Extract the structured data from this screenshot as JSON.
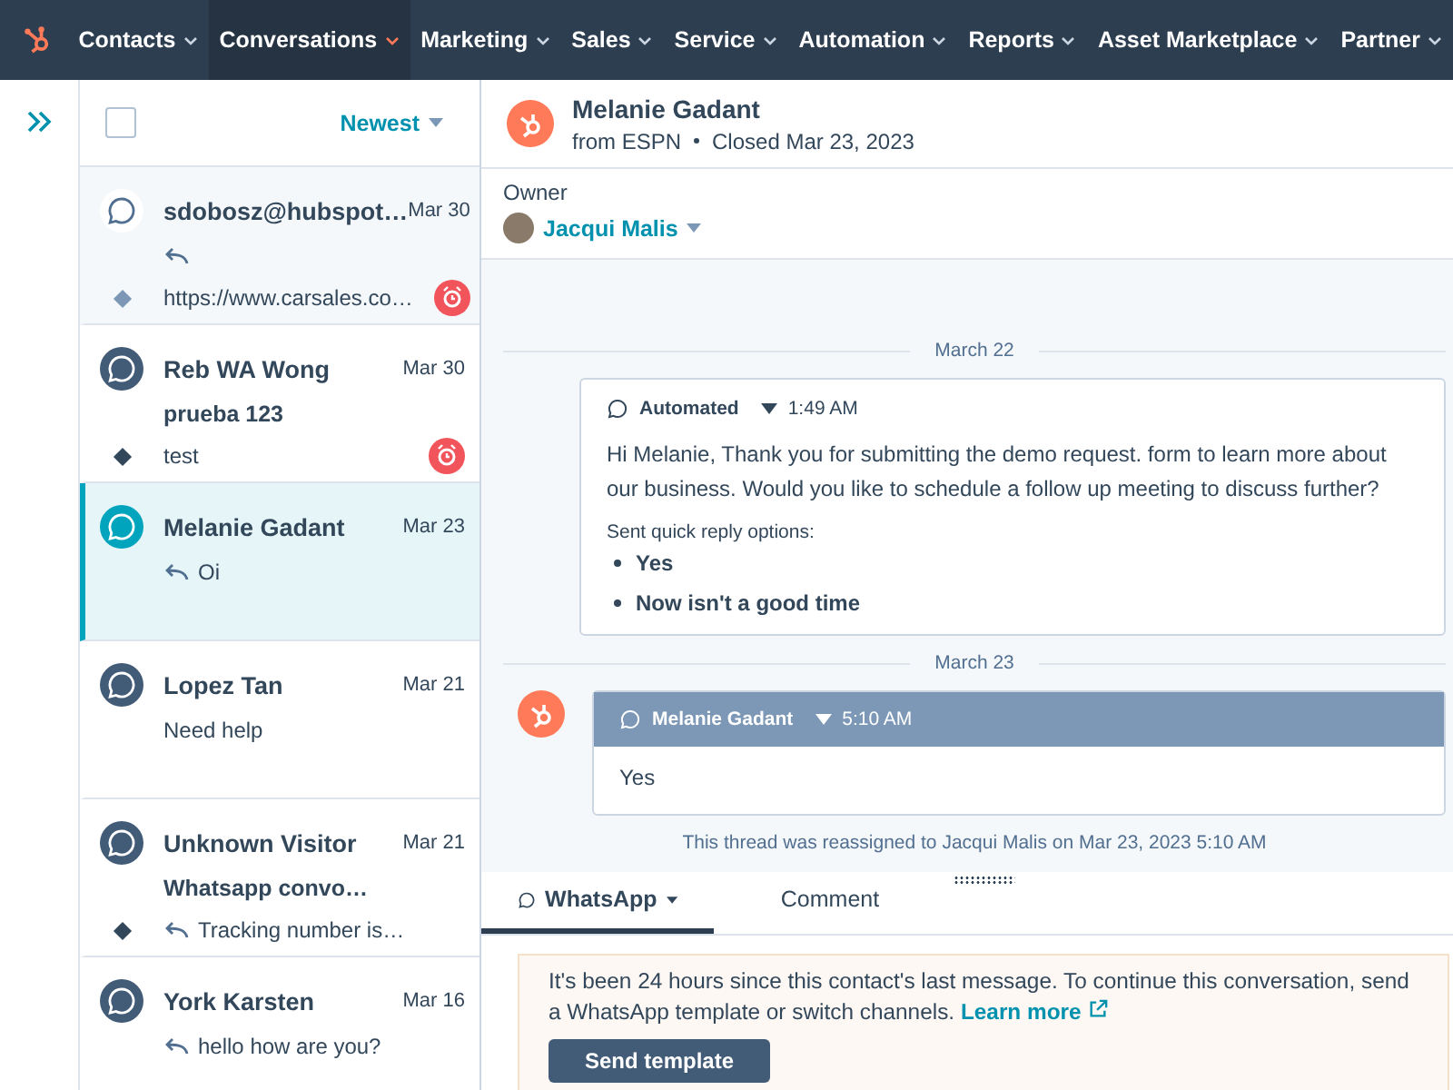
{
  "nav": {
    "items": [
      {
        "label": "Contacts",
        "selected": false
      },
      {
        "label": "Conversations",
        "selected": true
      },
      {
        "label": "Marketing",
        "selected": false
      },
      {
        "label": "Sales",
        "selected": false
      },
      {
        "label": "Service",
        "selected": false
      },
      {
        "label": "Automation",
        "selected": false
      },
      {
        "label": "Reports",
        "selected": false
      },
      {
        "label": "Asset Marketplace",
        "selected": false
      },
      {
        "label": "Partner",
        "selected": false
      }
    ]
  },
  "inbox": {
    "select_all": {
      "checked": false
    },
    "sort": "Newest",
    "conversations": [
      {
        "name": "sdobosz@hubspot…",
        "date": "Mar 30",
        "kind": "muted",
        "selected": false,
        "ticket": true,
        "alert": true,
        "lines": [
          {
            "kind": "preview",
            "reply": true
          },
          {
            "kind": "preview",
            "text": "https://www.carsales.co…",
            "reply": false
          }
        ]
      },
      {
        "name": "Reb WA Wong",
        "date": "Mar 30",
        "kind": "normal",
        "selected": false,
        "ticket": true,
        "alert": true,
        "lines": [
          {
            "kind": "subject",
            "text": "prueba 123",
            "reply": false
          },
          {
            "kind": "preview",
            "text": "test",
            "reply": false
          }
        ]
      },
      {
        "name": "Melanie Gadant",
        "date": "Mar 23",
        "kind": "normal",
        "selected": true,
        "ticket": false,
        "alert": false,
        "lines": [
          {
            "kind": "preview",
            "text": "Oi",
            "reply": true
          }
        ]
      },
      {
        "name": "Lopez Tan",
        "date": "Mar 21",
        "kind": "normal",
        "selected": false,
        "ticket": false,
        "alert": false,
        "lines": [
          {
            "kind": "preview",
            "text": "Need help",
            "reply": false
          }
        ]
      },
      {
        "name": "Unknown Visitor",
        "date": "Mar 21",
        "kind": "normal",
        "selected": false,
        "ticket": true,
        "alert": false,
        "lines": [
          {
            "kind": "subject",
            "text": "Whatsapp convo…",
            "reply": false
          },
          {
            "kind": "preview",
            "text": "Tracking number is…",
            "reply": true
          }
        ]
      },
      {
        "name": "York Karsten",
        "date": "Mar 16",
        "kind": "normal",
        "selected": false,
        "ticket": false,
        "alert": false,
        "lines": [
          {
            "kind": "preview",
            "text": "hello how are you?",
            "reply": true
          }
        ]
      }
    ]
  },
  "contact": {
    "name": "Melanie Gadant",
    "company": "from ESPN",
    "status": "Closed Mar 23, 2023",
    "owner_label": "Owner",
    "owner": "Jacqui Malis"
  },
  "thread": [
    {
      "kind": "date",
      "text": "March 22"
    },
    {
      "kind": "message",
      "sender": "Automated",
      "time": "1:49 AM",
      "incoming": false,
      "body": "Hi Melanie, Thank you for submitting the demo request. form to learn more about our business. Would you like to schedule a follow up meeting to discuss further?",
      "options_label": "Sent quick reply options:",
      "options": [
        "Yes",
        "Now isn't a good time"
      ]
    },
    {
      "kind": "date",
      "text": "March 23"
    },
    {
      "kind": "message",
      "sender": "Melanie Gadant",
      "time": "5:10 AM",
      "incoming": true,
      "body": "Yes"
    },
    {
      "kind": "event",
      "text": "This thread was reassigned to Jacqui Malis on Mar 23, 2023 5:10 AM"
    }
  ],
  "composer": {
    "tabs": [
      {
        "label": "WhatsApp",
        "selected": true
      },
      {
        "label": "Comment",
        "selected": false
      }
    ],
    "notice": "It's been 24 hours since this contact's last message. To continue this conversation, send a WhatsApp template or switch channels.",
    "notice_link": "Learn more",
    "button": "Send template"
  }
}
